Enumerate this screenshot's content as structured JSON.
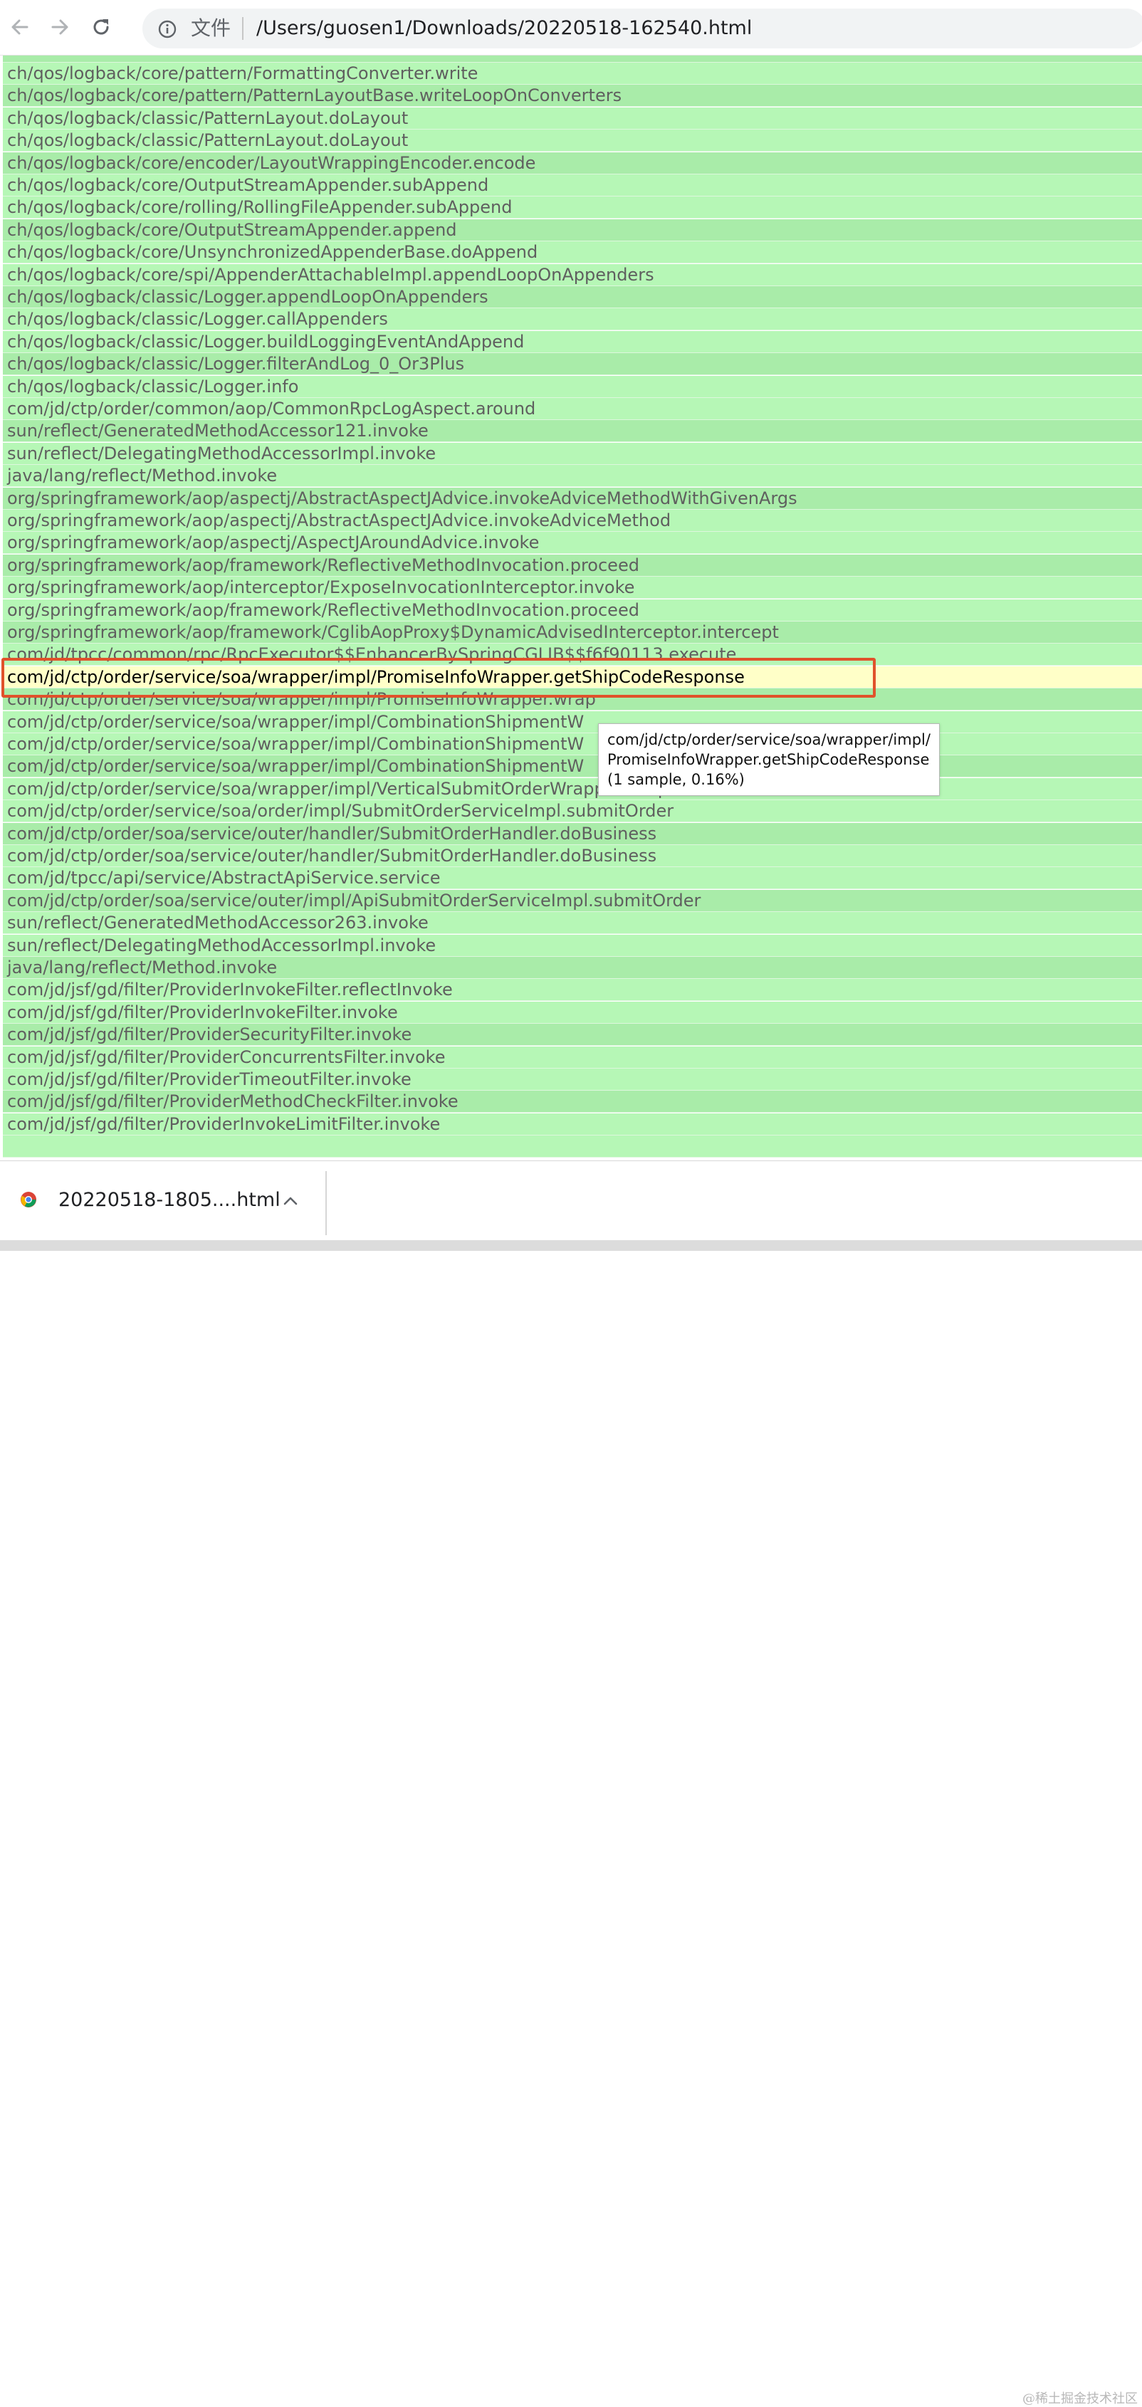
{
  "browser": {
    "scheme_label": "文件",
    "url": "/Users/guosen1/Downloads/20220518-162540.html",
    "icons": {
      "back": "back-arrow-icon",
      "forward": "forward-arrow-icon",
      "reload": "reload-icon",
      "info": "info-icon"
    }
  },
  "flamegraph": {
    "frames": [
      {
        "label": "ch/qos/logback/core/pattern/FormattingConverter.write"
      },
      {
        "label": "ch/qos/logback/core/pattern/PatternLayoutBase.writeLoopOnConverters"
      },
      {
        "label": "ch/qos/logback/classic/PatternLayout.doLayout"
      },
      {
        "label": "ch/qos/logback/classic/PatternLayout.doLayout"
      },
      {
        "label": "ch/qos/logback/core/encoder/LayoutWrappingEncoder.encode"
      },
      {
        "label": "ch/qos/logback/core/OutputStreamAppender.subAppend"
      },
      {
        "label": "ch/qos/logback/core/rolling/RollingFileAppender.subAppend"
      },
      {
        "label": "ch/qos/logback/core/OutputStreamAppender.append"
      },
      {
        "label": "ch/qos/logback/core/UnsynchronizedAppenderBase.doAppend"
      },
      {
        "label": "ch/qos/logback/core/spi/AppenderAttachableImpl.appendLoopOnAppenders"
      },
      {
        "label": "ch/qos/logback/classic/Logger.appendLoopOnAppenders"
      },
      {
        "label": "ch/qos/logback/classic/Logger.callAppenders"
      },
      {
        "label": "ch/qos/logback/classic/Logger.buildLoggingEventAndAppend"
      },
      {
        "label": "ch/qos/logback/classic/Logger.filterAndLog_0_Or3Plus"
      },
      {
        "label": "ch/qos/logback/classic/Logger.info"
      },
      {
        "label": "com/jd/ctp/order/common/aop/CommonRpcLogAspect.around"
      },
      {
        "label": "sun/reflect/GeneratedMethodAccessor121.invoke"
      },
      {
        "label": "sun/reflect/DelegatingMethodAccessorImpl.invoke"
      },
      {
        "label": "java/lang/reflect/Method.invoke"
      },
      {
        "label": "org/springframework/aop/aspectj/AbstractAspectJAdvice.invokeAdviceMethodWithGivenArgs"
      },
      {
        "label": "org/springframework/aop/aspectj/AbstractAspectJAdvice.invokeAdviceMethod"
      },
      {
        "label": "org/springframework/aop/aspectj/AspectJAroundAdvice.invoke"
      },
      {
        "label": "org/springframework/aop/framework/ReflectiveMethodInvocation.proceed"
      },
      {
        "label": "org/springframework/aop/interceptor/ExposeInvocationInterceptor.invoke"
      },
      {
        "label": "org/springframework/aop/framework/ReflectiveMethodInvocation.proceed"
      },
      {
        "label": "org/springframework/aop/framework/CglibAopProxy$DynamicAdvisedInterceptor.intercept"
      },
      {
        "label": "com/jd/tpcc/common/rpc/RpcExecutor$$EnhancerBySpringCGLIB$$f6f90113.execute"
      },
      {
        "label": "com/jd/ctp/order/service/soa/wrapper/impl/PromiseInfoWrapper.getShipCodeResponse",
        "hovered": true
      },
      {
        "label": "com/jd/ctp/order/service/soa/wrapper/impl/PromiseInfoWrapper.wrap"
      },
      {
        "label": "com/jd/ctp/order/service/soa/wrapper/impl/CombinationShipmentW"
      },
      {
        "label": "com/jd/ctp/order/service/soa/wrapper/impl/CombinationShipmentW"
      },
      {
        "label": "com/jd/ctp/order/service/soa/wrapper/impl/CombinationShipmentW"
      },
      {
        "label": "com/jd/ctp/order/service/soa/wrapper/impl/VerticalSubmitOrderWrapper.wrap"
      },
      {
        "label": "com/jd/ctp/order/service/soa/order/impl/SubmitOrderServiceImpl.submitOrder"
      },
      {
        "label": "com/jd/ctp/order/soa/service/outer/handler/SubmitOrderHandler.doBusiness"
      },
      {
        "label": "com/jd/ctp/order/soa/service/outer/handler/SubmitOrderHandler.doBusiness"
      },
      {
        "label": "com/jd/tpcc/api/service/AbstractApiService.service"
      },
      {
        "label": "com/jd/ctp/order/soa/service/outer/impl/ApiSubmitOrderServiceImpl.submitOrder"
      },
      {
        "label": "sun/reflect/GeneratedMethodAccessor263.invoke"
      },
      {
        "label": "sun/reflect/DelegatingMethodAccessorImpl.invoke"
      },
      {
        "label": "java/lang/reflect/Method.invoke"
      },
      {
        "label": "com/jd/jsf/gd/filter/ProviderInvokeFilter.reflectInvoke"
      },
      {
        "label": "com/jd/jsf/gd/filter/ProviderInvokeFilter.invoke"
      },
      {
        "label": "com/jd/jsf/gd/filter/ProviderSecurityFilter.invoke"
      },
      {
        "label": "com/jd/jsf/gd/filter/ProviderConcurrentsFilter.invoke"
      },
      {
        "label": "com/jd/jsf/gd/filter/ProviderTimeoutFilter.invoke"
      },
      {
        "label": "com/jd/jsf/gd/filter/ProviderMethodCheckFilter.invoke"
      },
      {
        "label": "com/jd/jsf/gd/filter/ProviderInvokeLimitFilter.invoke"
      }
    ],
    "colors": {
      "frame_fill_a": "#b6f7b6",
      "frame_fill_b": "#a9eca9",
      "frame_text": "#5f5f5f",
      "hover_fill": "#ffffc8",
      "highlight_border": "#e0522b"
    },
    "tooltip": {
      "line1": "com/jd/ctp/order/service/soa/wrapper/impl/",
      "line2": "PromiseInfoWrapper.getShipCodeResponse",
      "line3": "(1 sample, 0.16%)"
    }
  },
  "downloads": {
    "item_name": "20220518-1805....html",
    "icons": {
      "file": "chrome-file-icon",
      "menu": "chevron-up-icon"
    }
  },
  "watermark": "@稀土掘金技术社区"
}
